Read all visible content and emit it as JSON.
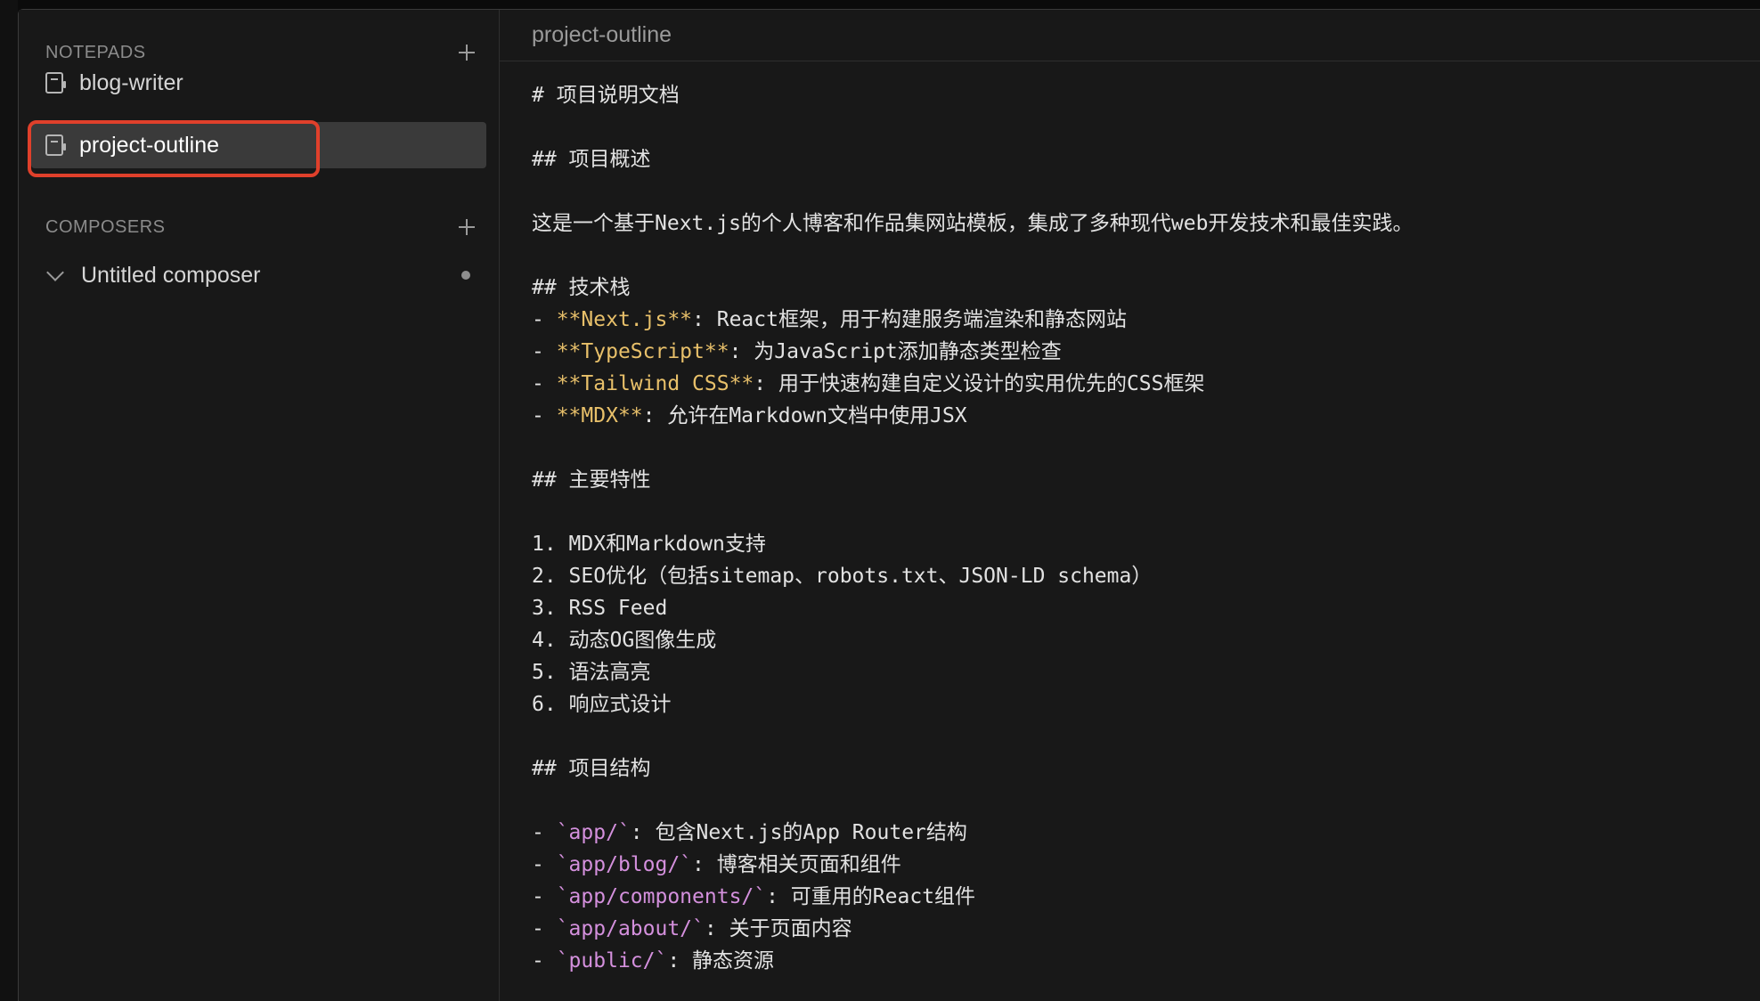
{
  "sidebar": {
    "notepads_title": "NOTEPADS",
    "composers_title": "COMPOSERS",
    "notepads": [
      {
        "label": "blog-writer"
      },
      {
        "label": "project-outline"
      }
    ],
    "composers": [
      {
        "label": "Untitled composer"
      }
    ]
  },
  "editor": {
    "tab_title": "project-outline",
    "lines": [
      "# 项目说明文档",
      "",
      "## 项目概述",
      "",
      "这是一个基于Next.js的个人博客和作品集网站模板，集成了多种现代web开发技术和最佳实践。",
      "",
      "## 技术栈",
      "",
      "",
      "",
      "",
      "",
      "## 主要特性",
      "",
      "1. MDX和Markdown支持",
      "2. SEO优化（包括sitemap、robots.txt、JSON-LD schema）",
      "3. RSS Feed",
      "4. 动态OG图像生成",
      "5. 语法高亮",
      "6. 响应式设计",
      "",
      "## 项目结构",
      ""
    ],
    "tech_stack": [
      {
        "prefix": "- ",
        "bold": "**Next.js**",
        "rest": ": React框架，用于构建服务端渲染和静态网站"
      },
      {
        "prefix": "- ",
        "bold": "**TypeScript**",
        "rest": ": 为JavaScript添加静态类型检查"
      },
      {
        "prefix": "- ",
        "bold": "**Tailwind CSS**",
        "rest": ": 用于快速构建自定义设计的实用优先的CSS框架"
      },
      {
        "prefix": "- ",
        "bold": "**MDX**",
        "rest": ": 允许在Markdown文档中使用JSX"
      }
    ],
    "structure": [
      {
        "prefix": "- ",
        "code": "`app/`",
        "rest": ": 包含Next.js的App Router结构"
      },
      {
        "prefix": "- ",
        "code": "`app/blog/`",
        "rest": ": 博客相关页面和组件"
      },
      {
        "prefix": "- ",
        "code": "`app/components/`",
        "rest": ": 可重用的React组件"
      },
      {
        "prefix": "- ",
        "code": "`app/about/`",
        "rest": ": 关于页面内容"
      },
      {
        "prefix": "- ",
        "code": "`public/`",
        "rest": ": 静态资源"
      }
    ]
  },
  "colors": {
    "selection_outline": "#e0402b",
    "bold_text": "#e8c06a",
    "code_text": "#d490dd"
  },
  "icons": {
    "notepad": "notepad-icon",
    "add": "plus-icon",
    "expand": "chevron-down-icon",
    "unsaved": "dot-indicator"
  }
}
